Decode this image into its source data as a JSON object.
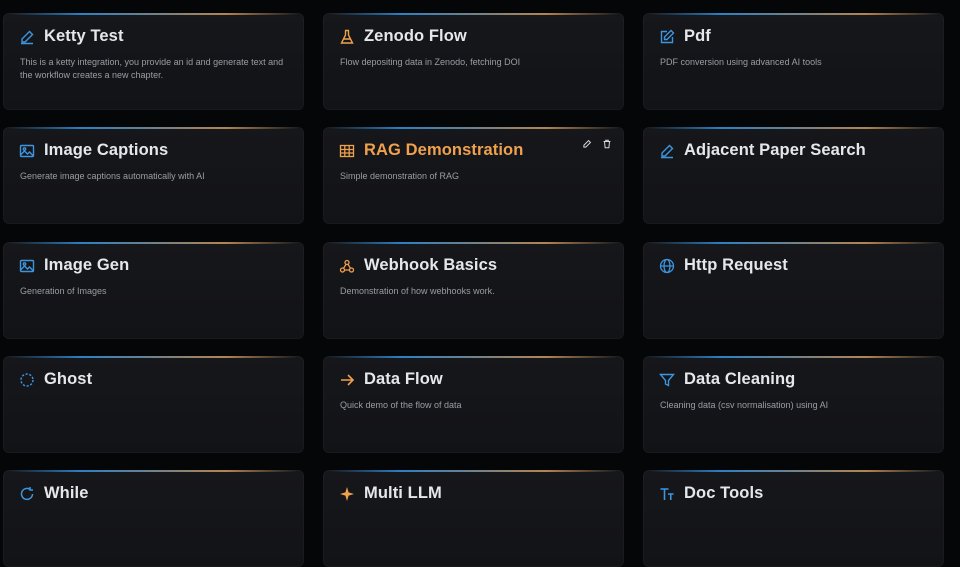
{
  "colors": {
    "blue_icon": "#3d95df",
    "orange_icon": "#f0a14d",
    "active_title": "#f0a14d"
  },
  "cards": [
    {
      "title": "Ketty Test",
      "description": "This is a ketty integration, you provide an id and generate text and the workflow creates a new chapter.",
      "icon": "pencil-icon"
    },
    {
      "title": "Zenodo Flow",
      "description": "Flow depositing data in Zenodo, fetching DOI",
      "icon": "flask-icon"
    },
    {
      "title": "Pdf",
      "description": "PDF conversion using advanced AI tools",
      "icon": "edit-square-icon"
    },
    {
      "title": "Image Captions",
      "description": "Generate image captions automatically with AI",
      "icon": "image-icon"
    },
    {
      "title": "RAG Demonstration",
      "description": "Simple demonstration of RAG",
      "icon": "table-icon"
    },
    {
      "title": "Adjacent Paper Search",
      "description": "",
      "icon": "pencil-icon"
    },
    {
      "title": "Image Gen",
      "description": "Generation of Images",
      "icon": "image-icon"
    },
    {
      "title": "Webhook Basics",
      "description": "Demonstration of how webhooks work.",
      "icon": "webhook-icon"
    },
    {
      "title": "Http Request",
      "description": "",
      "icon": "globe-icon"
    },
    {
      "title": "Ghost",
      "description": "",
      "icon": "dashed-circle-icon"
    },
    {
      "title": "Data Flow",
      "description": "Quick demo of the flow of data",
      "icon": "arrow-right-icon"
    },
    {
      "title": "Data Cleaning",
      "description": "Cleaning data (csv normalisation) using AI",
      "icon": "filter-icon"
    },
    {
      "title": "While",
      "description": "",
      "icon": "refresh-icon"
    },
    {
      "title": "Multi LLM",
      "description": "",
      "icon": "sparkle-icon"
    },
    {
      "title": "Doc Tools",
      "description": "",
      "icon": "text-icon"
    }
  ]
}
